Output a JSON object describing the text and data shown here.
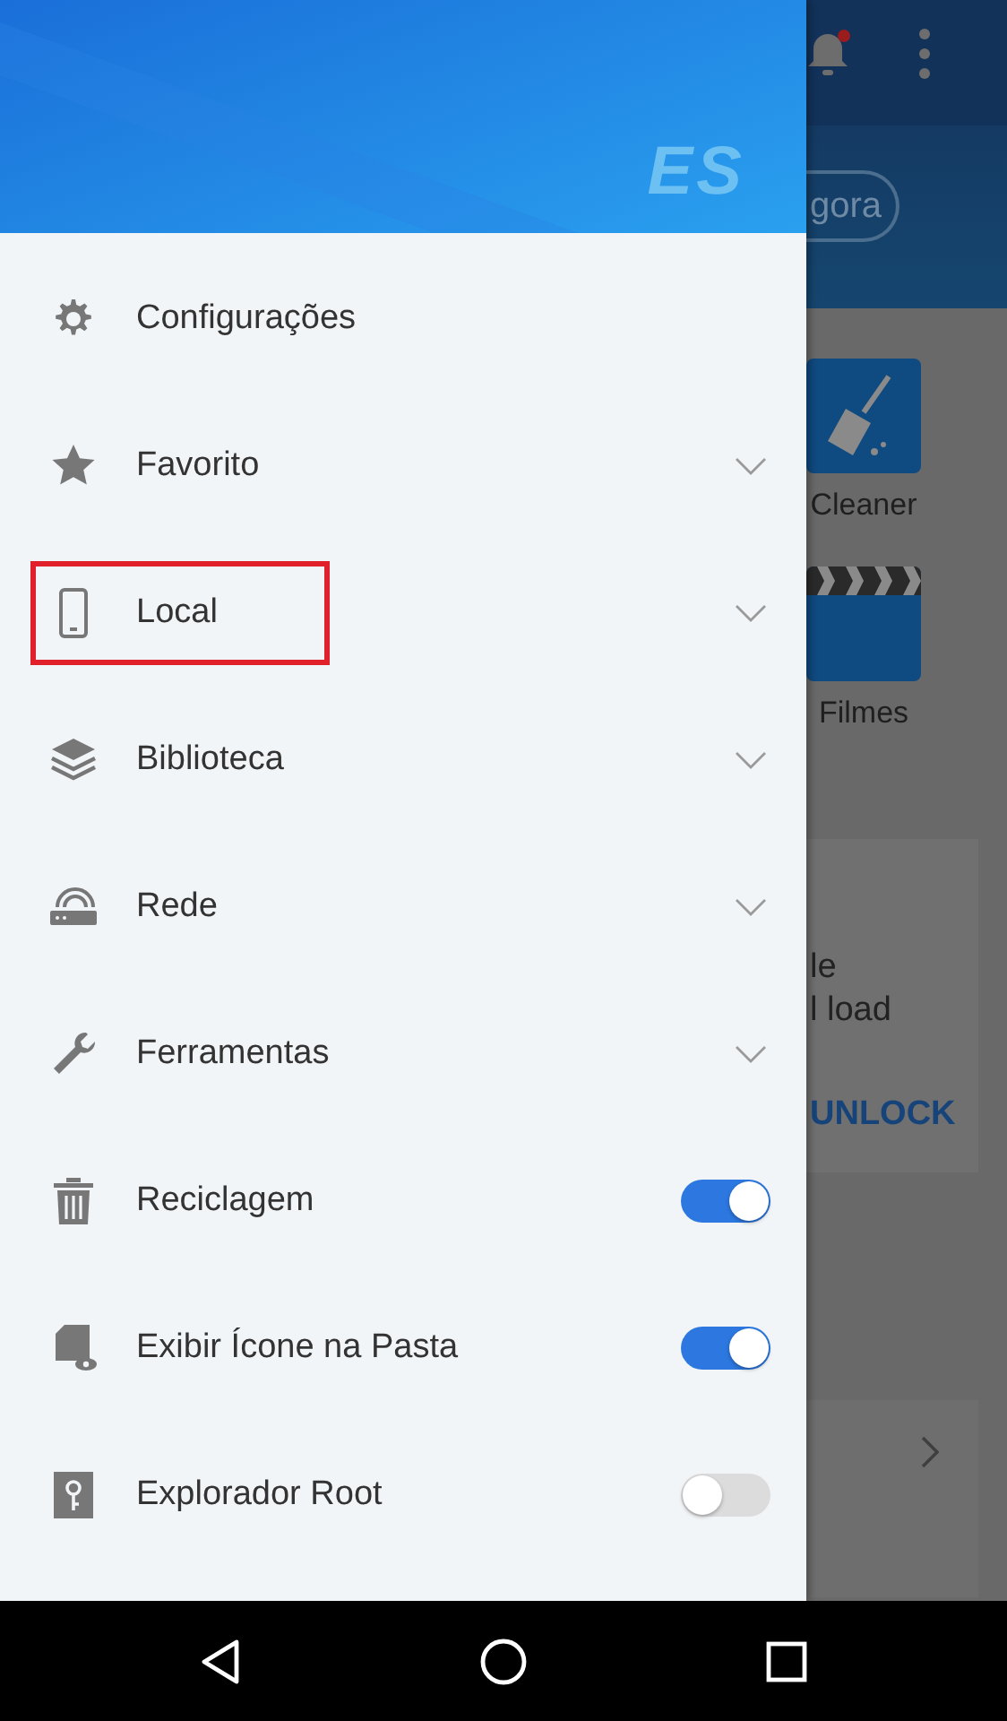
{
  "drawer": {
    "logo": "ES",
    "items": [
      {
        "label": "Configurações",
        "kind": "plain",
        "highlighted": false
      },
      {
        "label": "Favorito",
        "kind": "expand",
        "highlighted": false
      },
      {
        "label": "Local",
        "kind": "expand",
        "highlighted": true
      },
      {
        "label": "Biblioteca",
        "kind": "expand",
        "highlighted": false
      },
      {
        "label": "Rede",
        "kind": "expand",
        "highlighted": false
      },
      {
        "label": "Ferramentas",
        "kind": "expand",
        "highlighted": false
      },
      {
        "label": "Reciclagem",
        "kind": "toggle",
        "on": true,
        "highlighted": false
      },
      {
        "label": "Exibir Ícone na Pasta",
        "kind": "toggle",
        "on": true,
        "highlighted": false
      },
      {
        "label": "Explorador Root",
        "kind": "toggle",
        "on": false,
        "highlighted": false
      }
    ]
  },
  "background": {
    "button": "gora",
    "tiles": [
      {
        "label": "Cleaner"
      },
      {
        "label": "Filmes"
      }
    ],
    "card": {
      "lines": [
        "le",
        "l load"
      ],
      "action": "UNLOCK"
    }
  }
}
